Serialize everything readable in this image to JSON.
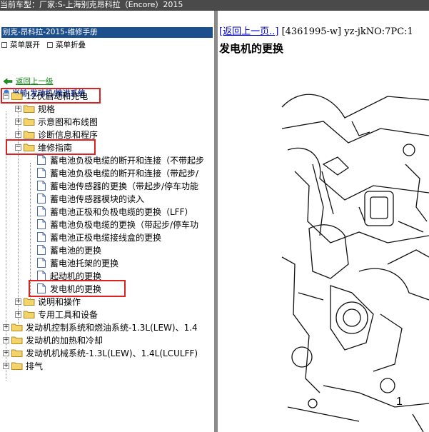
{
  "top_bar": {
    "text": "当前车型：厂家:S-上海别克昂科拉（Encore）2015"
  },
  "manual": {
    "title": "别克-昂科拉-2015-维修手册"
  },
  "toolbar": {
    "expand_label": "菜单展开",
    "collapse_label": "菜单折叠"
  },
  "nav": {
    "back_label": "返回上一级",
    "current_label": "当前:发动机/推进系统"
  },
  "tree": [
    {
      "label": "12伏启动和充电",
      "toggle": "−",
      "type": "folder"
    },
    {
      "label": "规格",
      "toggle": "+",
      "type": "folder"
    },
    {
      "label": "示意图和布线图",
      "toggle": "+",
      "type": "folder"
    },
    {
      "label": "诊断信息和程序",
      "toggle": "+",
      "type": "folder"
    },
    {
      "label": "维修指南",
      "toggle": "−",
      "type": "folder"
    },
    {
      "label": "蓄电池负极电缆的断开和连接（不带起步",
      "type": "doc"
    },
    {
      "label": "蓄电池负极电缆的断开和连接（带起步/",
      "type": "doc"
    },
    {
      "label": "蓄电池传感器的更换（带起步/停车功能",
      "type": "doc"
    },
    {
      "label": "蓄电池传感器模块的读入",
      "type": "doc"
    },
    {
      "label": "蓄电池正极和负极电缆的更换（LFF）",
      "type": "doc"
    },
    {
      "label": "蓄电池负极电缆的更换（带起步/停车功",
      "type": "doc"
    },
    {
      "label": "蓄电池正极电缆接线盒的更换",
      "type": "doc"
    },
    {
      "label": "蓄电池的更换",
      "type": "doc"
    },
    {
      "label": "蓄电池托架的更换",
      "type": "doc"
    },
    {
      "label": "起动机的更换",
      "type": "doc"
    },
    {
      "label": "发电机的更换",
      "type": "doc"
    },
    {
      "label": "说明和操作",
      "toggle": "+",
      "type": "folder"
    },
    {
      "label": "专用工具和设备",
      "toggle": "+",
      "type": "folder"
    },
    {
      "label": "发动机控制系统和燃油系统-1.3L(LEW)、1.4",
      "toggle": "+",
      "type": "folder"
    },
    {
      "label": "发动机的加热和冷却",
      "toggle": "+",
      "type": "folder"
    },
    {
      "label": "发动机机械系统-1.3L(LEW)、1.4L(LCULFF)",
      "toggle": "+",
      "type": "folder"
    },
    {
      "label": "排气",
      "toggle": "+",
      "type": "folder"
    }
  ],
  "content": {
    "back_link": "[返回上一页..]",
    "doc_id": "[4361995-w]",
    "meta": "yz-jkNO:7PC:1",
    "title": "发电机的更换",
    "callout": "1"
  },
  "colors": {
    "title_bar": "#1c4f8c",
    "highlight": "#dd2222",
    "link": "#0000cc",
    "back_link": "#0a8a0a"
  }
}
